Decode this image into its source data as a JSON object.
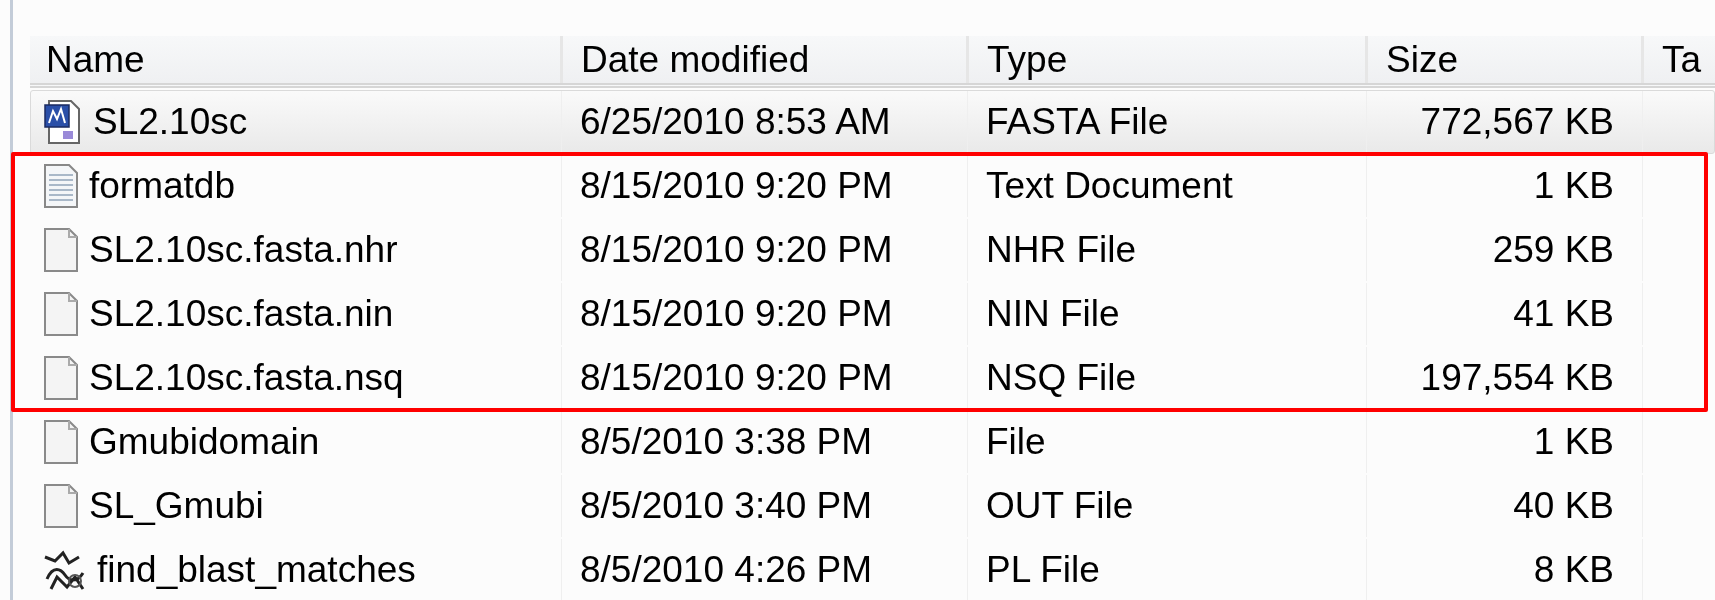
{
  "columns": [
    "Name",
    "Date modified",
    "Type",
    "Size",
    "Ta"
  ],
  "rows": [
    {
      "kind": "app",
      "name": "SL2.10sc",
      "date": "6/25/2010 8:53 AM",
      "type": "FASTA File",
      "size": "772,567 KB",
      "selected": true,
      "highlighted": false
    },
    {
      "kind": "text",
      "name": "formatdb",
      "date": "8/15/2010 9:20 PM",
      "type": "Text Document",
      "size": "1 KB",
      "selected": false,
      "highlighted": true
    },
    {
      "kind": "blank",
      "name": "SL2.10sc.fasta.nhr",
      "date": "8/15/2010 9:20 PM",
      "type": "NHR File",
      "size": "259 KB",
      "selected": false,
      "highlighted": true
    },
    {
      "kind": "blank",
      "name": "SL2.10sc.fasta.nin",
      "date": "8/15/2010 9:20 PM",
      "type": "NIN File",
      "size": "41 KB",
      "selected": false,
      "highlighted": true
    },
    {
      "kind": "blank",
      "name": "SL2.10sc.fasta.nsq",
      "date": "8/15/2010 9:20 PM",
      "type": "NSQ File",
      "size": "197,554 KB",
      "selected": false,
      "highlighted": true
    },
    {
      "kind": "blank",
      "name": "Gmubidomain",
      "date": "8/5/2010 3:38 PM",
      "type": "File",
      "size": "1 KB",
      "selected": false,
      "highlighted": false
    },
    {
      "kind": "blank",
      "name": "SL_Gmubi",
      "date": "8/5/2010 3:40 PM",
      "type": "OUT File",
      "size": "40 KB",
      "selected": false,
      "highlighted": false
    },
    {
      "kind": "script",
      "name": "find_blast_matches",
      "date": "8/5/2010 4:26 PM",
      "type": "PL File",
      "size": "8 KB",
      "selected": false,
      "highlighted": false
    }
  ]
}
